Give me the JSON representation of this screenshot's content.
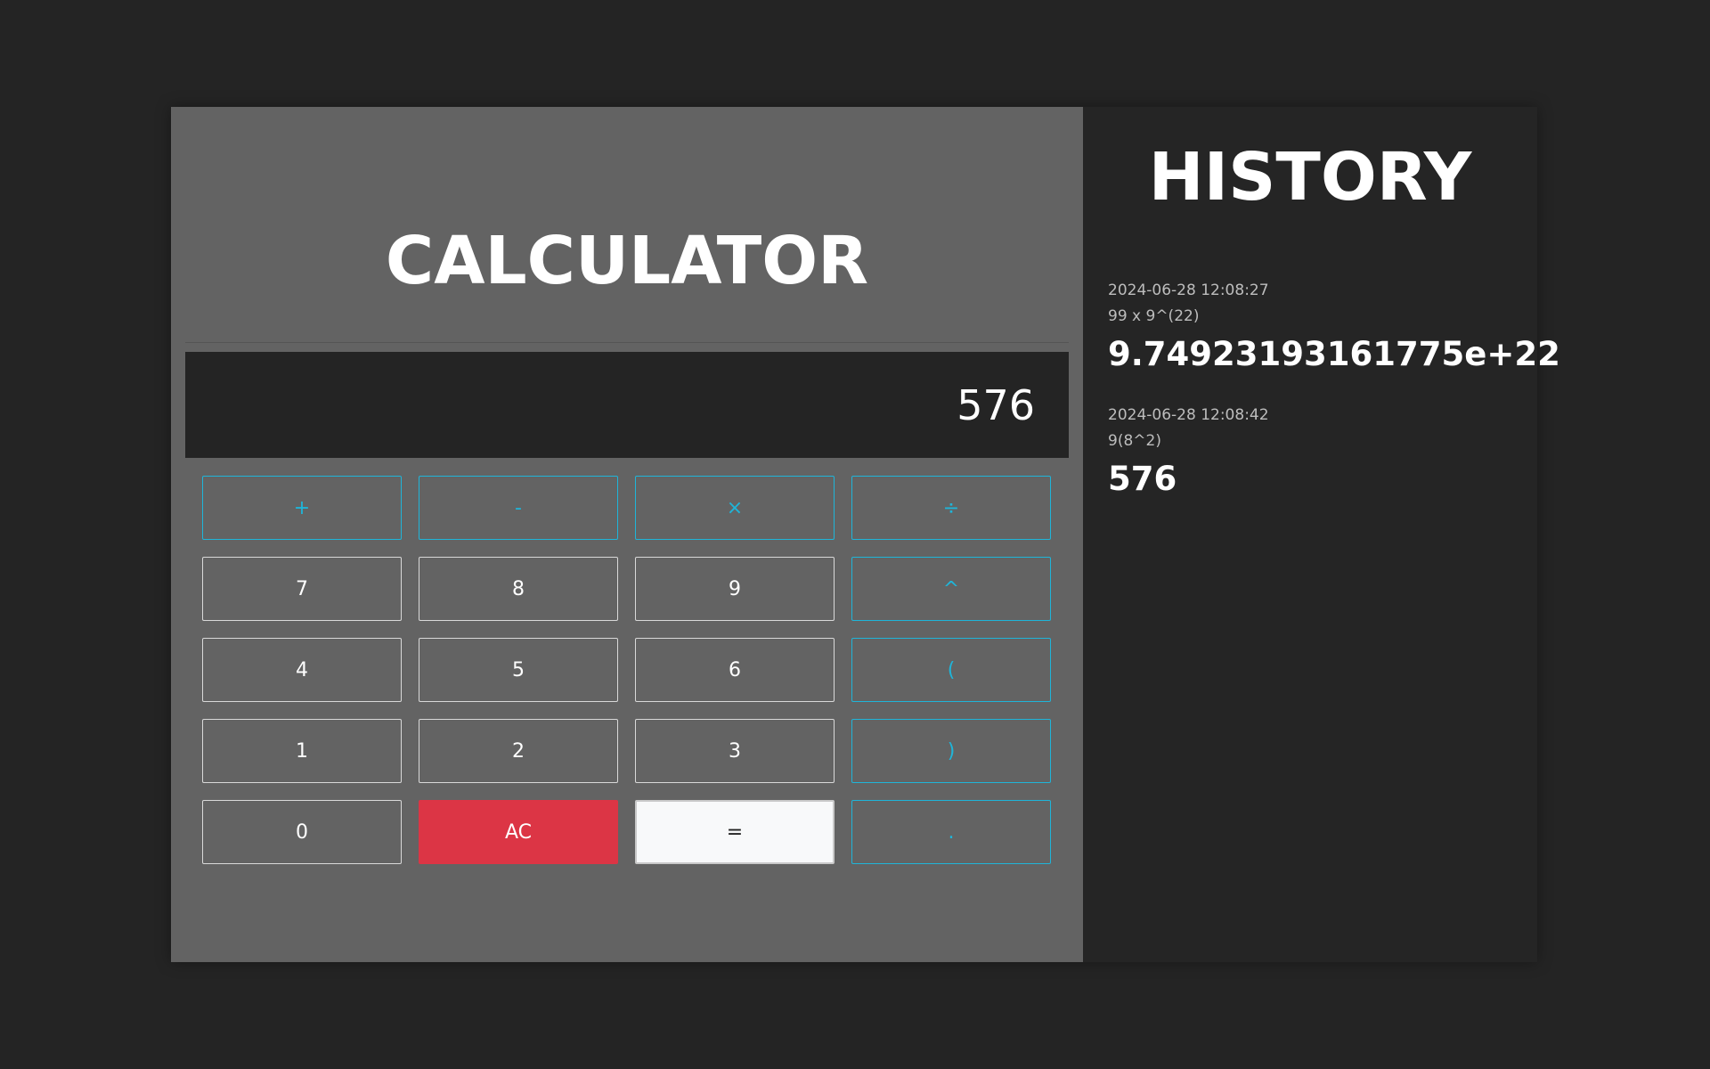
{
  "calculator": {
    "title": "CALCULATOR",
    "display_value": "576",
    "keys": [
      {
        "label": "+",
        "name": "key-plus",
        "kind": "op"
      },
      {
        "label": "-",
        "name": "key-minus",
        "kind": "op"
      },
      {
        "label": "×",
        "name": "key-multiply",
        "kind": "op"
      },
      {
        "label": "÷",
        "name": "key-divide",
        "kind": "op"
      },
      {
        "label": "7",
        "name": "key-7",
        "kind": "num"
      },
      {
        "label": "8",
        "name": "key-8",
        "kind": "num"
      },
      {
        "label": "9",
        "name": "key-9",
        "kind": "num"
      },
      {
        "label": "^",
        "name": "key-power",
        "kind": "op"
      },
      {
        "label": "4",
        "name": "key-4",
        "kind": "num"
      },
      {
        "label": "5",
        "name": "key-5",
        "kind": "num"
      },
      {
        "label": "6",
        "name": "key-6",
        "kind": "num"
      },
      {
        "label": "(",
        "name": "key-open-paren",
        "kind": "op"
      },
      {
        "label": "1",
        "name": "key-1",
        "kind": "num"
      },
      {
        "label": "2",
        "name": "key-2",
        "kind": "num"
      },
      {
        "label": "3",
        "name": "key-3",
        "kind": "num"
      },
      {
        "label": ")",
        "name": "key-close-paren",
        "kind": "op"
      },
      {
        "label": "0",
        "name": "key-0",
        "kind": "num"
      },
      {
        "label": "AC",
        "name": "clear-button",
        "kind": "ac"
      },
      {
        "label": "=",
        "name": "equals-button",
        "kind": "eq"
      },
      {
        "label": ".",
        "name": "key-decimal",
        "kind": "op"
      }
    ]
  },
  "history": {
    "title": "HISTORY",
    "entries": [
      {
        "timestamp": "2024-06-28 12:08:27",
        "expression": "99 x 9^(22)",
        "result": "9.74923193161775e+22"
      },
      {
        "timestamp": "2024-06-28 12:08:42",
        "expression": "9(8^2)",
        "result": "576"
      }
    ]
  },
  "colors": {
    "accent": "#1fb5d9",
    "clear": "#dc3545",
    "panel": "#636363",
    "background": "#242424"
  }
}
